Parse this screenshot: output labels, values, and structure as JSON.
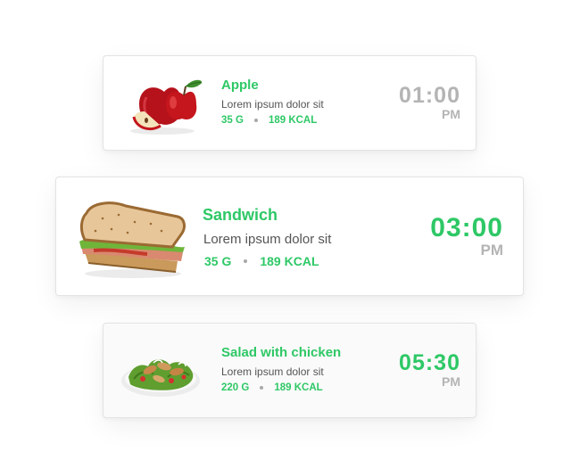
{
  "accent_color": "#2ec866",
  "muted_color": "#b4b4b4",
  "meals": [
    {
      "name": "Apple",
      "description": "Lorem ipsum dolor sit",
      "weight": "35 G",
      "calories": "189 KCAL",
      "time": "01:00",
      "period": "PM",
      "image_icon": "apple-icon"
    },
    {
      "name": "Sandwich",
      "description": "Lorem ipsum dolor sit",
      "weight": "35 G",
      "calories": "189 KCAL",
      "time": "03:00",
      "period": "PM",
      "image_icon": "sandwich-icon"
    },
    {
      "name": "Salad with chicken",
      "description": "Lorem ipsum dolor sit",
      "weight": "220 G",
      "calories": "189 KCAL",
      "time": "05:30",
      "period": "PM",
      "image_icon": "salad-icon"
    }
  ]
}
